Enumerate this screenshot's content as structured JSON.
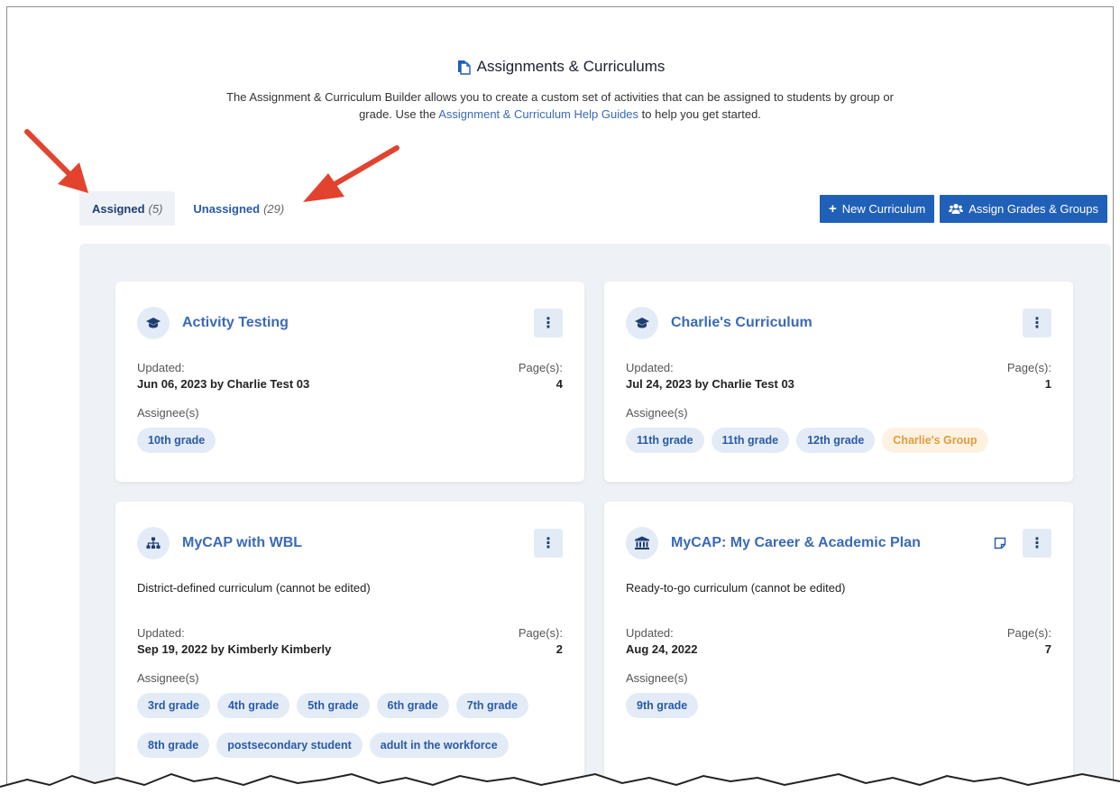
{
  "header": {
    "title": "Assignments & Curriculums",
    "desc_before": "The Assignment & Curriculum Builder allows you to create a custom set of activities that can be assigned to students by group or grade. Use the ",
    "desc_link": "Assignment & Curriculum Help Guides",
    "desc_after": " to help you get started."
  },
  "tabs": [
    {
      "label": "Assigned",
      "count": "(5)"
    },
    {
      "label": "Unassigned",
      "count": "(29)"
    }
  ],
  "actions": {
    "new_curriculum": "New Curriculum",
    "assign_grades_groups": "Assign Grades & Groups"
  },
  "labels": {
    "updated": "Updated:",
    "pages": "Page(s):",
    "assignees": "Assignee(s)"
  },
  "cards": [
    {
      "title": "Activity Testing",
      "icon": "graduation-cap-icon",
      "updated": "Jun 06, 2023 by Charlie Test 03",
      "pages": "4",
      "assignees": [
        "10th grade"
      ]
    },
    {
      "title": "Charlie's Curriculum",
      "icon": "graduation-cap-icon",
      "updated": "Jul 24, 2023 by Charlie Test 03",
      "pages": "1",
      "assignees": [
        "11th grade",
        "11th grade",
        "12th grade"
      ],
      "groups": [
        "Charlie's Group"
      ]
    },
    {
      "title": "MyCAP with WBL",
      "icon": "org-chart-icon",
      "note": "District-defined curriculum (cannot be edited)",
      "updated": "Sep 19, 2022 by Kimberly Kimberly",
      "pages": "2",
      "assignees": [
        "3rd grade",
        "4th grade",
        "5th grade",
        "6th grade",
        "7th grade",
        "8th grade",
        "postsecondary student",
        "adult in the workforce"
      ]
    },
    {
      "title": "MyCAP: My Career & Academic Plan",
      "icon": "institution-icon",
      "note": "Ready-to-go curriculum (cannot be edited)",
      "updated": "Aug 24, 2022",
      "pages": "7",
      "assignees": [
        "9th grade"
      ]
    }
  ],
  "colors": {
    "accent": "#2060b8",
    "link": "#3a6ab8",
    "tag_bg": "#e3ebf6",
    "group_tag": "#e59a3c",
    "annotation_arrow": "#e2432f"
  }
}
